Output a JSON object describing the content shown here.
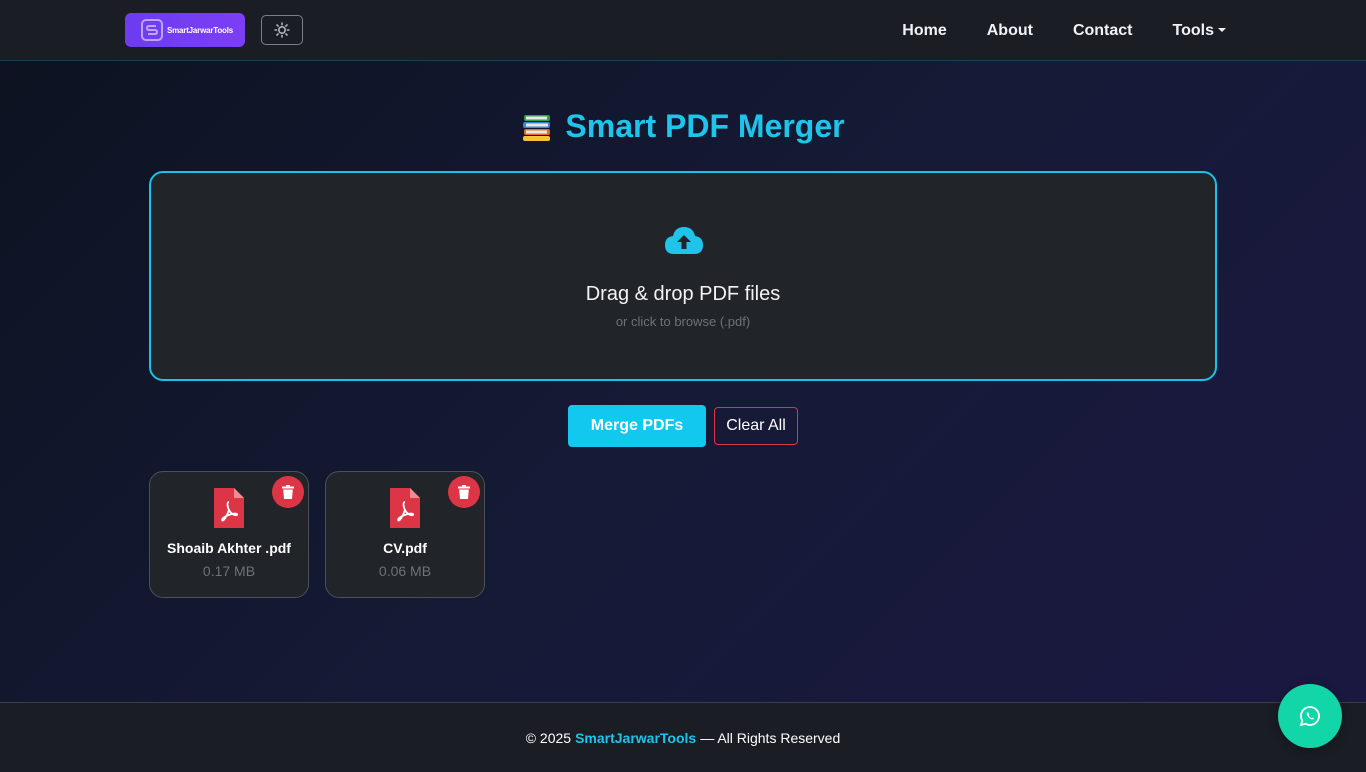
{
  "nav": {
    "brand": "SmartJarwarTools",
    "links": [
      "Home",
      "About",
      "Contact",
      "Tools"
    ]
  },
  "page": {
    "title": "Smart PDF Merger"
  },
  "dropzone": {
    "title": "Drag & drop PDF files",
    "subtitle": "or click to browse (.pdf)"
  },
  "actions": {
    "merge_label": "Merge PDFs",
    "clear_label": "Clear All"
  },
  "files": [
    {
      "name": "Shoaib Akhter .pdf",
      "size": "0.17 MB"
    },
    {
      "name": "CV.pdf",
      "size": "0.06 MB"
    }
  ],
  "footer": {
    "prefix": "© 2025",
    "brand": "SmartJarwarTools",
    "suffix": "— All Rights Reserved"
  },
  "colors": {
    "accent": "#1ec4ea",
    "danger": "#dc3545",
    "brand_purple": "#6d3cf0",
    "whatsapp": "#12d6a8"
  },
  "icons": [
    "logo-icon",
    "sun-icon",
    "books-icon",
    "cloud-upload-icon",
    "pdf-file-icon",
    "trash-icon",
    "whatsapp-icon"
  ]
}
